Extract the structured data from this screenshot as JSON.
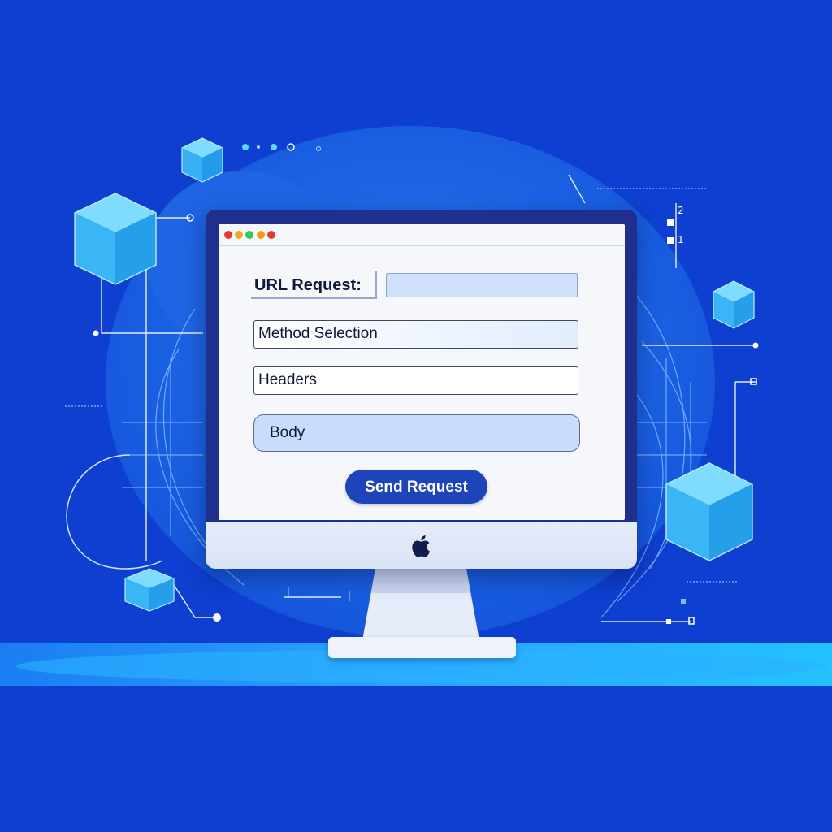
{
  "window": {
    "control_dots": [
      {
        "name": "red",
        "color": "#e53935"
      },
      {
        "name": "orange",
        "color": "#f5a623"
      },
      {
        "name": "green",
        "color": "#34c759"
      },
      {
        "name": "orange-2",
        "color": "#f39c12"
      },
      {
        "name": "red-2",
        "color": "#e53935"
      }
    ]
  },
  "form": {
    "url_label": "URL Request:",
    "url_value": "",
    "method_label": "Method Selection",
    "headers_label": "Headers",
    "body_label": "Body",
    "send_label": "Send Request"
  },
  "decor": {
    "top_readout": "• : . • . o . o",
    "side_numbers": [
      "2",
      "1"
    ]
  },
  "colors": {
    "background": "#0f3fd0",
    "globe": "#1f6ae6",
    "button": "#1d44b8",
    "monitor_frame": "#1e2f8c",
    "cube": "#3fb6f5"
  },
  "icons": {
    "monitor_logo": "apple-logo-icon"
  }
}
